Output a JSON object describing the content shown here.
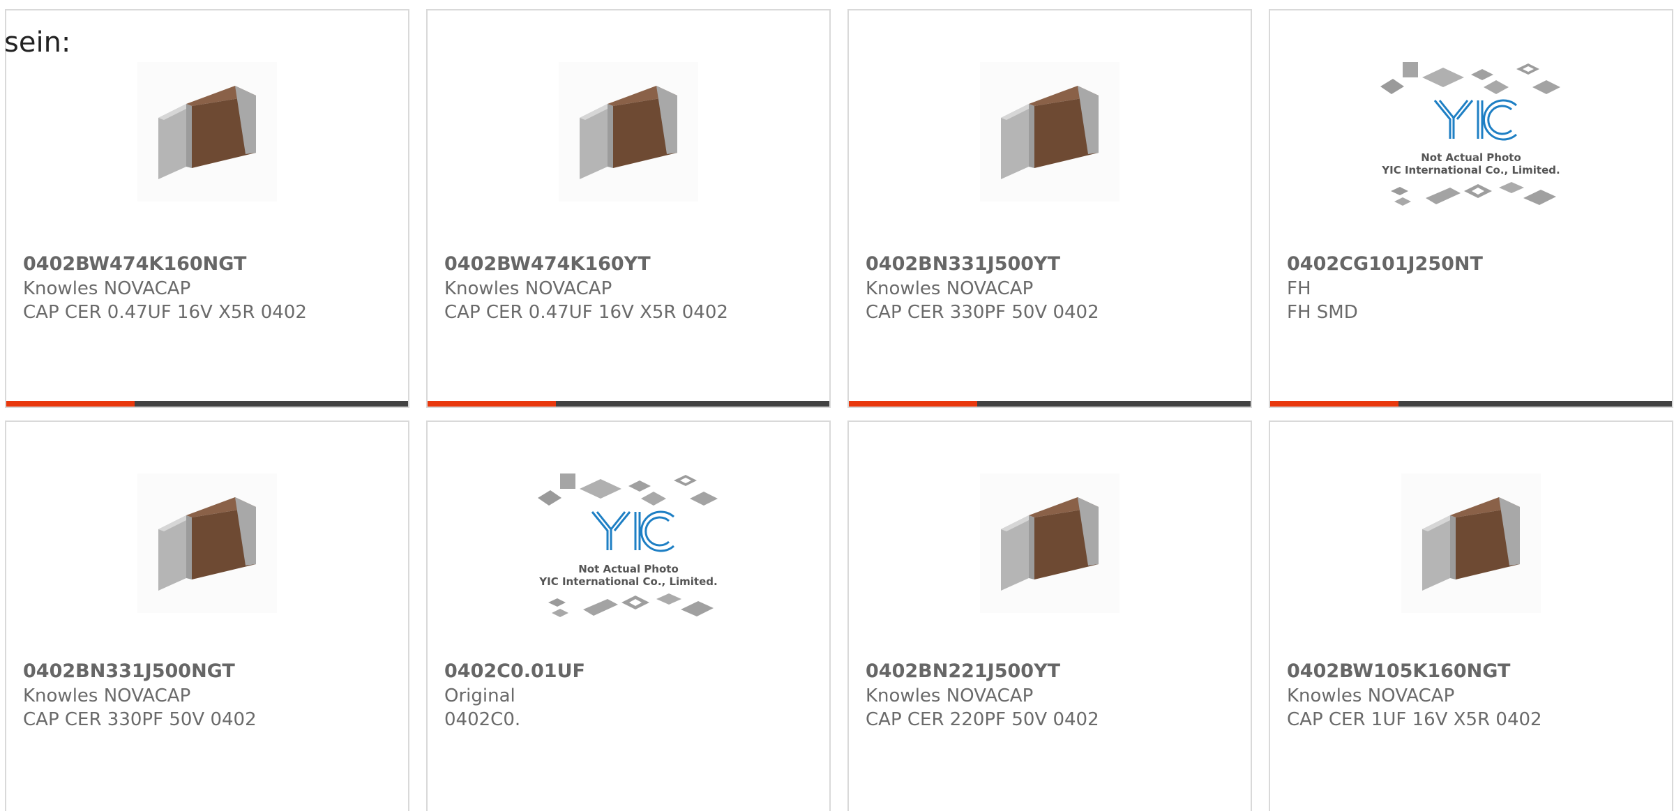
{
  "intro_text": "sein:",
  "colors": {
    "accent": "#e8380d",
    "bar_dark": "#424242",
    "card_border": "#d9d9d9",
    "text_gray": "#666666",
    "chip_body": "#6e4a33",
    "chip_end": "#b5b5b5",
    "logo_blue": "#1e7fc4"
  },
  "placeholder_image": {
    "line1": "Not Actual Photo",
    "line2": "YIC International Co., Limited."
  },
  "products": [
    {
      "part_number": "0402BW474K160NGT",
      "manufacturer": "Knowles NOVACAP",
      "description": "CAP CER 0.47UF 16V X5R 0402",
      "image": "capacitor-chip",
      "progress": 0.32
    },
    {
      "part_number": "0402BW474K160YT",
      "manufacturer": "Knowles NOVACAP",
      "description": "CAP CER 0.47UF 16V X5R 0402",
      "image": "capacitor-chip",
      "progress": 0.32
    },
    {
      "part_number": "0402BN331J500YT",
      "manufacturer": "Knowles NOVACAP",
      "description": "CAP CER 330PF 50V 0402",
      "image": "capacitor-chip",
      "progress": 0.32
    },
    {
      "part_number": "0402CG101J250NT",
      "manufacturer": "FH",
      "description": "FH SMD",
      "image": "yic-placeholder",
      "progress": 0.32
    },
    {
      "part_number": "0402BN331J500NGT",
      "manufacturer": "Knowles NOVACAP",
      "description": "CAP CER 330PF 50V 0402",
      "image": "capacitor-chip",
      "progress": null
    },
    {
      "part_number": "0402C0.01UF",
      "manufacturer": "Original",
      "description": "0402C0.",
      "image": "yic-placeholder",
      "progress": null
    },
    {
      "part_number": "0402BN221J500YT",
      "manufacturer": "Knowles NOVACAP",
      "description": "CAP CER 220PF 50V 0402",
      "image": "capacitor-chip",
      "progress": null
    },
    {
      "part_number": "0402BW105K160NGT",
      "manufacturer": "Knowles NOVACAP",
      "description": "CAP CER 1UF 16V X5R 0402",
      "image": "capacitor-chip",
      "progress": null
    }
  ]
}
